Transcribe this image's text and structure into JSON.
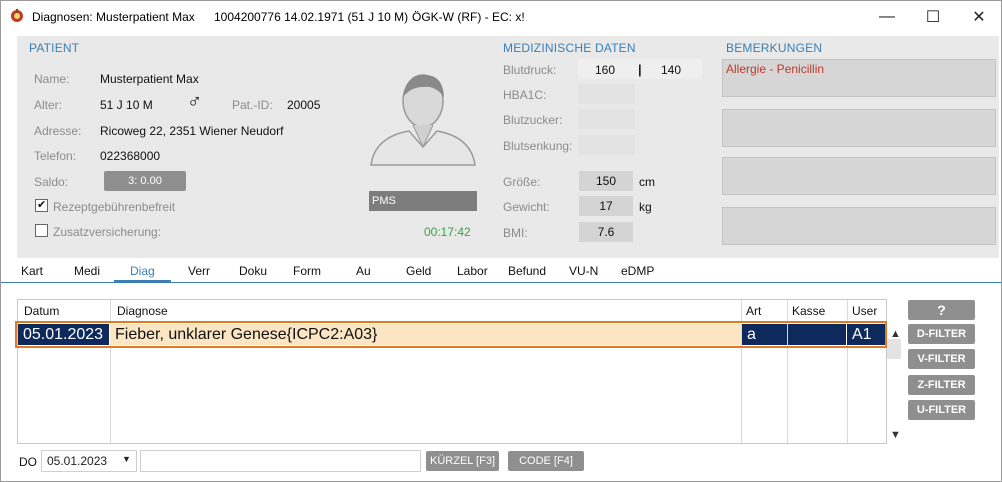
{
  "window": {
    "title_prefix": "Diagnosen: Musterpatient Max",
    "title_patient": "1004200776 14.02.1971 (51 J 10 M)",
    "title_insurance": "ÖGK-W (RF) - EC: x!",
    "minimize_glyph": "—",
    "maximize_glyph": "☐",
    "close_glyph": "✕"
  },
  "patient": {
    "section_title": "PATIENT",
    "name_label": "Name:",
    "name": "Musterpatient Max",
    "age_label": "Alter:",
    "age": "51 J 10 M",
    "gender_symbol": "♂",
    "pat_id_label": "Pat.-ID:",
    "pat_id": "20005",
    "address_label": "Adresse:",
    "address": "Ricoweg 22, 2351 Wiener Neudorf",
    "phone_label": "Telefon:",
    "phone": "022368000",
    "saldo_label": "Saldo:",
    "saldo": "3: 0.00",
    "rezept_label": "Rezeptgebührenbefreit",
    "rezept_checked": true,
    "zusatz_label": "Zusatzversicherung:",
    "zusatz_checked": false,
    "pms_label": "PMS",
    "timer": "00:17:42"
  },
  "medical": {
    "section_title": "MEDIZINISCHE DATEN",
    "bp_label": "Blutdruck:",
    "bp_sys": "160",
    "bp_separator": "|",
    "bp_dia": "140",
    "hba1c_label": "HBA1C:",
    "sugar_label": "Blutzucker:",
    "sed_label": "Blutsenkung:",
    "height_label": "Größe:",
    "height": "150",
    "height_unit": "cm",
    "weight_label": "Gewicht:",
    "weight": "17",
    "weight_unit": "kg",
    "bmi_label": "BMI:",
    "bmi": "7.6"
  },
  "remarks": {
    "section_title": "BEMERKUNGEN",
    "first": "Allergie - Penicillin"
  },
  "tabs": [
    "Kart",
    "Medi",
    "Diag",
    "Verr",
    "Doku",
    "Form",
    "Au",
    "Geld",
    "Labor",
    "Befund",
    "VU-N",
    "eDMP"
  ],
  "active_tab": "Diag",
  "table": {
    "headers": {
      "datum": "Datum",
      "diagnose": "Diagnose",
      "art": "Art",
      "kasse": "Kasse",
      "user": "User"
    },
    "rows": [
      {
        "datum": "05.01.2023",
        "diagnose": "Fieber, unklarer Genese{ICPC2:A03}",
        "art": "a",
        "kasse": "",
        "user": "A1"
      }
    ]
  },
  "filters": {
    "help": "?",
    "d": "D-FILTER",
    "v": "V-FILTER",
    "z": "Z-FILTER",
    "u": "U-FILTER"
  },
  "footer": {
    "do_label": "DO",
    "date": "05.01.2023",
    "text_value": "",
    "kuerzel_button": "KÜRZEL [F3]",
    "code_button": "CODE [F4]"
  },
  "colors": {
    "accent": "#3b7fb6",
    "selected_row": "#0e2a5c",
    "row_highlight": "#fbe5c2",
    "row_border": "#e07b24",
    "remark_text": "#c0392b",
    "timer": "#3aa14a"
  }
}
